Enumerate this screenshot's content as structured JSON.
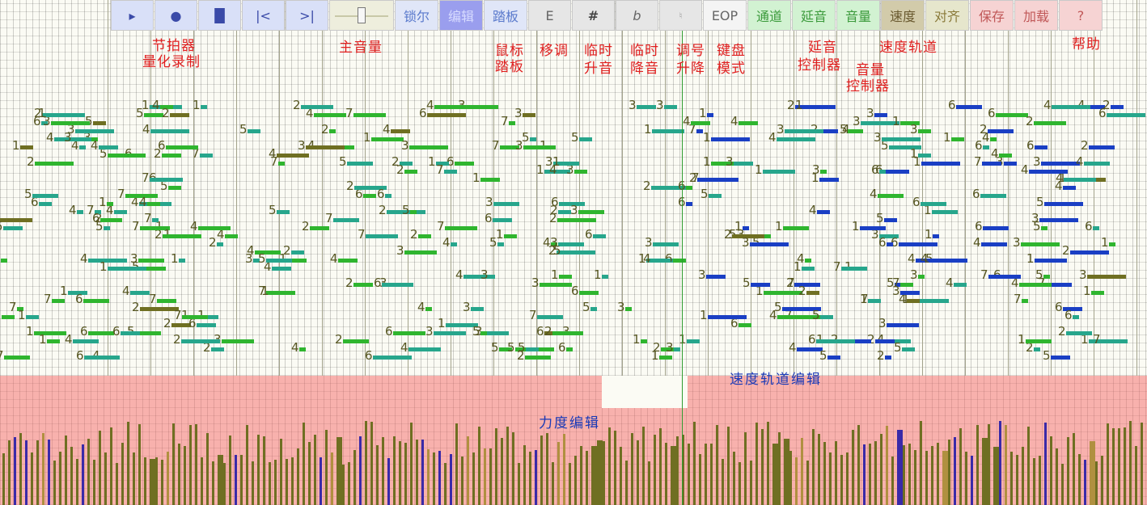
{
  "toolbar": {
    "transport": [
      "▸",
      "●",
      "█",
      "|<",
      ">|"
    ],
    "modes": [
      "锁尔",
      "编辑",
      "踏板"
    ],
    "active_mode": "编辑",
    "keys": [
      "E",
      "#",
      "b",
      "♮"
    ],
    "eop": "EOP",
    "controls": [
      "通道",
      "延音",
      "音量"
    ],
    "tempo": "速度",
    "align": "对齐",
    "save": "保存",
    "load": "加载",
    "help": "?"
  },
  "annotations": {
    "metronome": "节拍器",
    "quantize": "量化录制",
    "master_volume": "主音量",
    "mouse": "鼠标",
    "pedal": "踏板",
    "transpose": "移调",
    "acc_sharp_1": "临时",
    "acc_sharp_2": "升音",
    "acc_flat_1": "临时",
    "acc_flat_2": "降音",
    "key_sig_1": "调号",
    "key_sig_2": "升降",
    "kb_mode_1": "键盘",
    "kb_mode_2": "模式",
    "sustain_1": "延音",
    "sustain_2": "控制器",
    "volume_1": "音量",
    "volume_2": "控制器",
    "tempo_track": "速度轨道",
    "help": "帮助",
    "tempo_track_edit": "速度轨道编辑",
    "velocity_edit": "力度编辑"
  },
  "colors": {
    "note_green": "#2fb52f",
    "note_teal": "#27a68c",
    "note_blue": "#1a3fc4",
    "note_olive": "#6f6f22",
    "velocity_bg": "#f8b1ad",
    "annotation_red": "#e02020",
    "annotation_blue": "#1a3ab8"
  }
}
